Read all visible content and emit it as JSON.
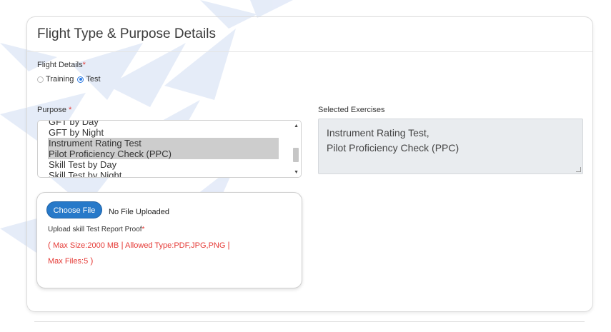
{
  "header": {
    "title": "Flight Type & Purpose Details"
  },
  "flight_details": {
    "label": "Flight Details",
    "required_mark": "*",
    "options": [
      {
        "label": "Training",
        "checked": false
      },
      {
        "label": "Test",
        "checked": true
      }
    ]
  },
  "purpose": {
    "label": "Purpose",
    "required_mark": "*",
    "options": [
      {
        "label": "GFT by Day",
        "selected": false
      },
      {
        "label": "GFT by Night",
        "selected": false
      },
      {
        "label": "Instrument Rating Test",
        "selected": true
      },
      {
        "label": "Pilot Proficiency Check (PPC)",
        "selected": true
      },
      {
        "label": "Skill Test by Day",
        "selected": false
      },
      {
        "label": "Skill Test by Night",
        "selected": false
      }
    ]
  },
  "selected_exercises": {
    "label": "Selected Exercises",
    "lines": [
      "Instrument Rating Test,",
      "Pilot Proficiency Check (PPC)"
    ]
  },
  "upload": {
    "button_label": "Choose File",
    "status": "No File Uploaded",
    "label": "Upload skill Test Report Proof",
    "required_mark": "*",
    "max_size": "Max Size:2000 MB",
    "allowed_types": "Allowed Type:PDF,JPG,PNG",
    "max_files": "Max Files:5",
    "open_paren": "(",
    "close_paren": ")",
    "separator": "|"
  },
  "colors": {
    "accent": "#2779c9",
    "required": "#e53935",
    "selected_option_bg": "#cdcdcd",
    "readonly_bg": "#e9ecef"
  },
  "icons": [
    "paper-plane-watermark-icon",
    "scroll-up-arrow-icon",
    "scroll-down-arrow-icon",
    "resize-handle-icon"
  ]
}
